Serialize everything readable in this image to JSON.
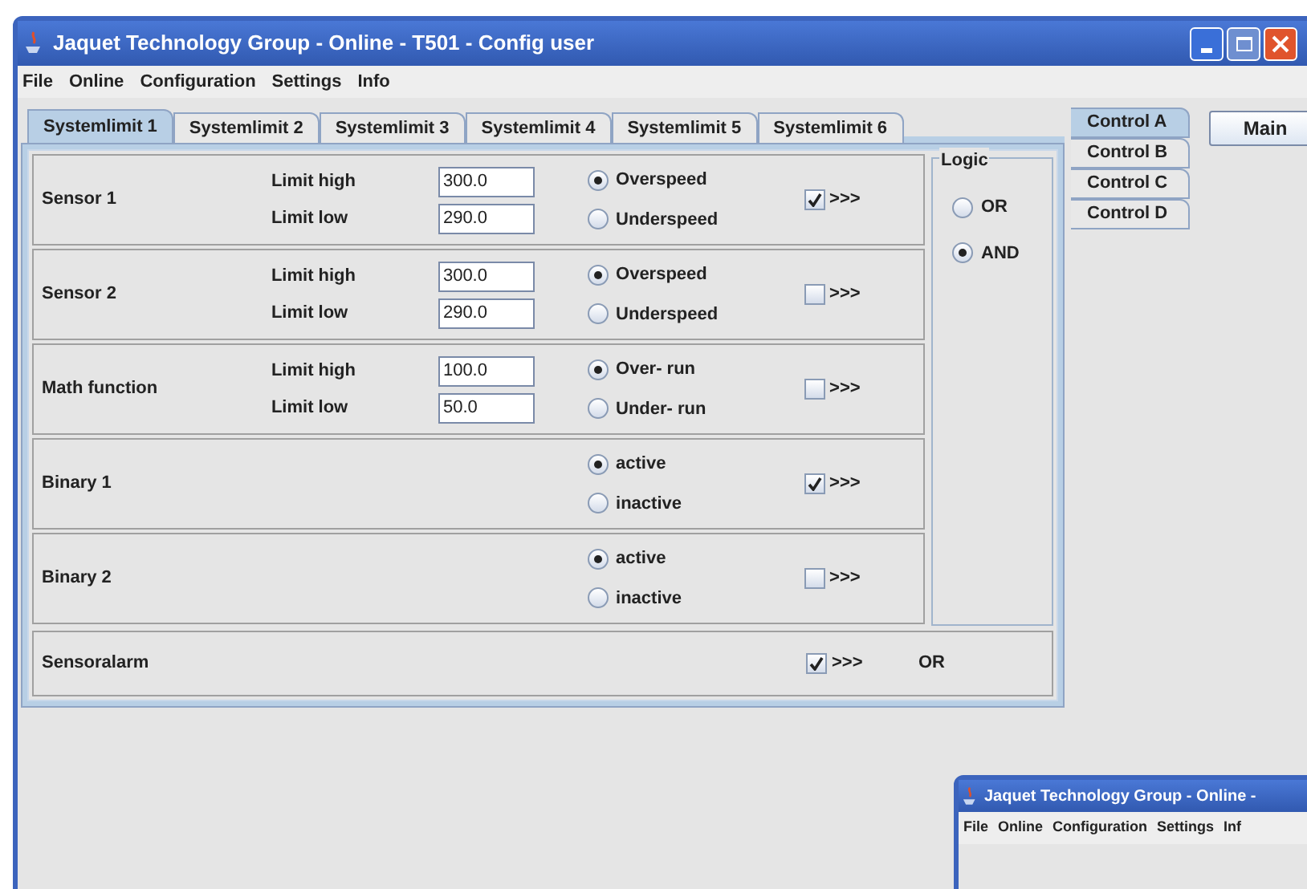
{
  "window": {
    "title": "Jaquet Technology Group - Online - T501 - Config user"
  },
  "menu": [
    "File",
    "Online",
    "Configuration",
    "Settings",
    "Info"
  ],
  "tabs": [
    {
      "label": "Systemlimit 1",
      "selected": true
    },
    {
      "label": "Systemlimit 2",
      "selected": false
    },
    {
      "label": "Systemlimit 3",
      "selected": false
    },
    {
      "label": "Systemlimit 4",
      "selected": false
    },
    {
      "label": "Systemlimit 5",
      "selected": false
    },
    {
      "label": "Systemlimit 6",
      "selected": false
    }
  ],
  "sections": [
    {
      "kind": "limits",
      "name": "Sensor 1",
      "limits": [
        {
          "label": "Limit high",
          "value": "300.0"
        },
        {
          "label": "Limit low",
          "value": "290.0"
        }
      ],
      "options": [
        {
          "label": "Overspeed",
          "selected": true
        },
        {
          "label": "Underspeed",
          "selected": false
        }
      ],
      "checked": true,
      "arrow": ">>>"
    },
    {
      "kind": "limits",
      "name": "Sensor 2",
      "limits": [
        {
          "label": "Limit high",
          "value": "300.0"
        },
        {
          "label": "Limit low",
          "value": "290.0"
        }
      ],
      "options": [
        {
          "label": "Overspeed",
          "selected": true
        },
        {
          "label": "Underspeed",
          "selected": false
        }
      ],
      "checked": false,
      "arrow": ">>>"
    },
    {
      "kind": "limits",
      "name": "Math function",
      "limits": [
        {
          "label": "Limit high",
          "value": "100.0"
        },
        {
          "label": "Limit low",
          "value": "50.0"
        }
      ],
      "options": [
        {
          "label": "Over- run",
          "selected": true
        },
        {
          "label": "Under- run",
          "selected": false
        }
      ],
      "checked": false,
      "arrow": ">>>"
    },
    {
      "kind": "binary",
      "name": "Binary 1",
      "options": [
        {
          "label": "active",
          "selected": true
        },
        {
          "label": "inactive",
          "selected": false
        }
      ],
      "checked": true,
      "arrow": ">>>"
    },
    {
      "kind": "binary",
      "name": "Binary 2",
      "options": [
        {
          "label": "active",
          "selected": true
        },
        {
          "label": "inactive",
          "selected": false
        }
      ],
      "checked": false,
      "arrow": ">>>"
    }
  ],
  "logic": {
    "title": "Logic",
    "options": [
      {
        "label": "OR",
        "selected": false
      },
      {
        "label": "AND",
        "selected": true
      }
    ]
  },
  "sensoralarm": {
    "name": "Sensoralarm",
    "checked": true,
    "arrow": ">>>",
    "logic": "OR"
  },
  "side_tabs": [
    {
      "label": "Control A",
      "selected": true
    },
    {
      "label": "Control B",
      "selected": false
    },
    {
      "label": "Control C",
      "selected": false
    },
    {
      "label": "Control D",
      "selected": false
    }
  ],
  "main_button": "Main",
  "second_window": {
    "title": "Jaquet Technology Group - Online -",
    "menu": [
      "File",
      "Online",
      "Configuration",
      "Settings",
      "Inf"
    ]
  }
}
